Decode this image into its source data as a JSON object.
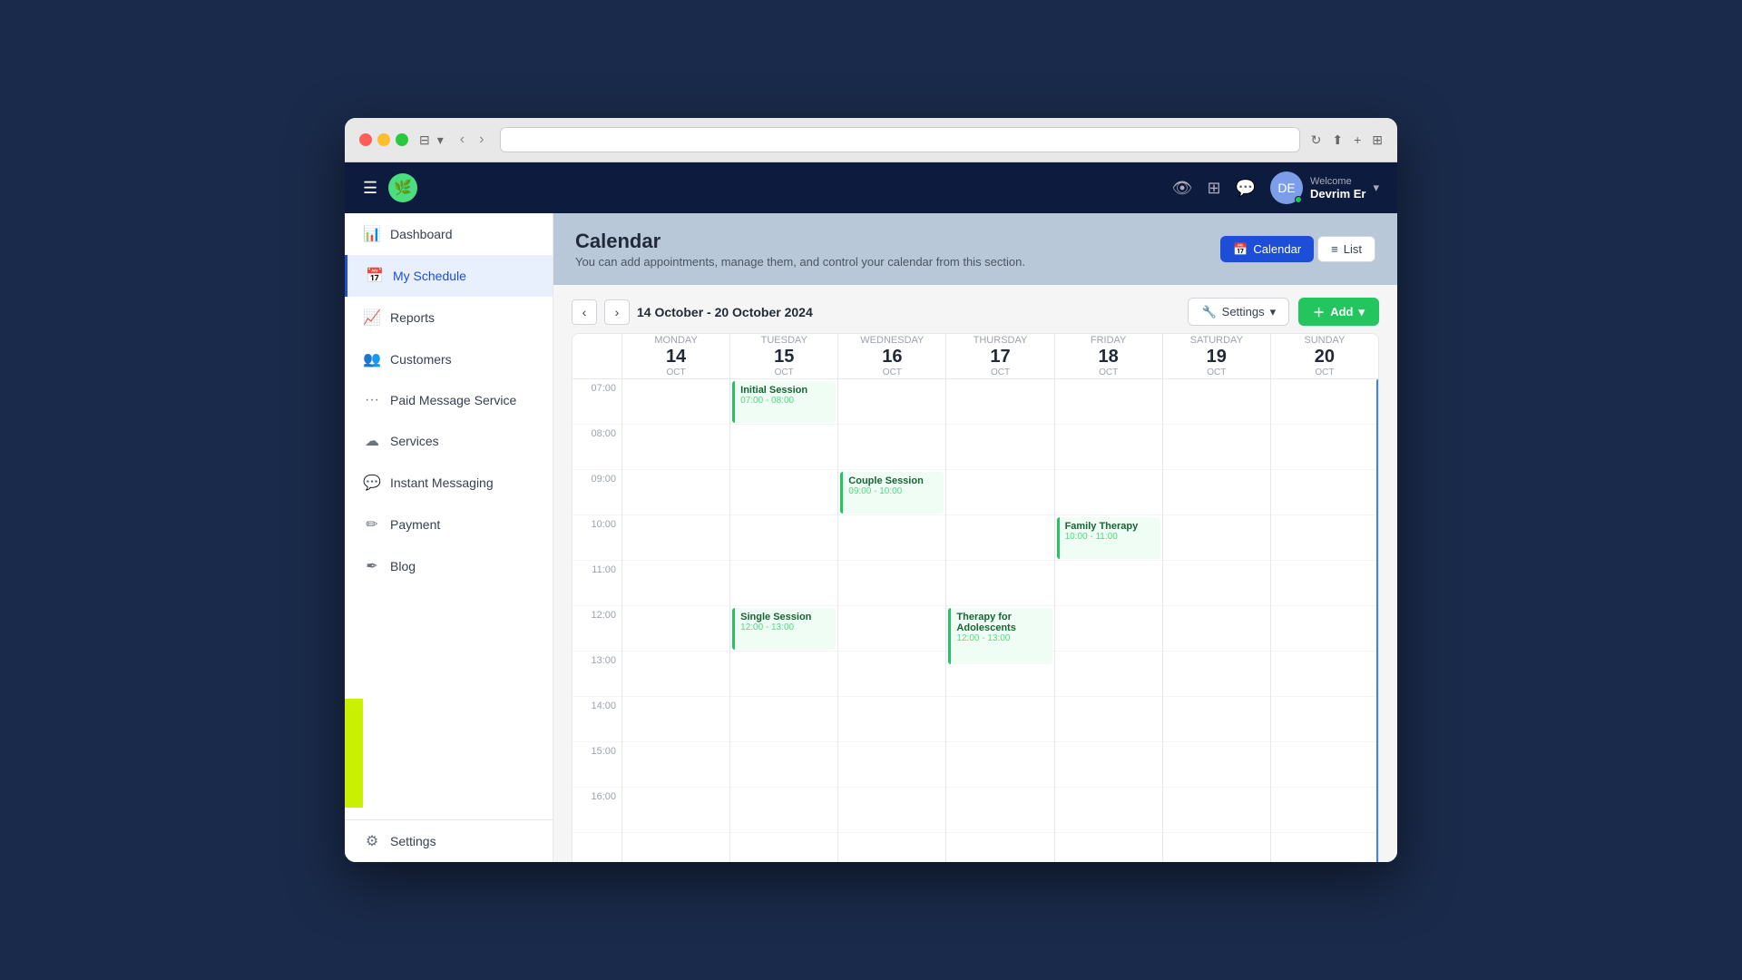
{
  "browser": {
    "back_label": "‹",
    "forward_label": "›",
    "refresh_label": "↻",
    "share_label": "⬆",
    "add_tab_label": "+",
    "grid_label": "⊞"
  },
  "topnav": {
    "hamburger_label": "☰",
    "logo_emoji": "🌿",
    "welcome_text": "Welcome",
    "username": "Devrim Er",
    "chevron": "▾",
    "icon_eye": "👁",
    "icon_grid": "⊞",
    "icon_chat": "💬"
  },
  "sidebar": {
    "items": [
      {
        "id": "dashboard",
        "label": "Dashboard",
        "icon": "📊"
      },
      {
        "id": "my-schedule",
        "label": "My Schedule",
        "icon": "📅",
        "active": true
      },
      {
        "id": "reports",
        "label": "Reports",
        "icon": "📈"
      },
      {
        "id": "customers",
        "label": "Customers",
        "icon": "👥"
      },
      {
        "id": "paid-message",
        "label": "Paid Message Service",
        "icon": "···"
      },
      {
        "id": "services",
        "label": "Services",
        "icon": "☁"
      },
      {
        "id": "instant-messaging",
        "label": "Instant Messaging",
        "icon": "💬"
      },
      {
        "id": "payment",
        "label": "Payment",
        "icon": "✏"
      },
      {
        "id": "blog",
        "label": "Blog",
        "icon": "✒"
      }
    ],
    "bottom_items": [
      {
        "id": "settings",
        "label": "Settings",
        "icon": "⚙"
      }
    ]
  },
  "page_header": {
    "title": "Calendar",
    "subtitle": "You can add appointments, manage them, and control your calendar from this section.",
    "view_calendar_label": "Calendar",
    "view_list_label": "List"
  },
  "calendar": {
    "date_range": "14 October - 20 October 2024",
    "settings_label": "Settings",
    "add_label": "+ Add",
    "days": [
      {
        "name": "Monday",
        "number": "14",
        "month": "OCT"
      },
      {
        "name": "Tuesday",
        "number": "15",
        "month": "OCT"
      },
      {
        "name": "Wednesday",
        "number": "16",
        "month": "OCT"
      },
      {
        "name": "Thursday",
        "number": "17",
        "month": "OCT"
      },
      {
        "name": "Friday",
        "number": "18",
        "month": "OCT"
      },
      {
        "name": "Saturday",
        "number": "19",
        "month": "OCT"
      },
      {
        "name": "Sunday",
        "number": "20",
        "month": "OCT"
      }
    ],
    "time_slots": [
      "07:00",
      "08:00",
      "09:00",
      "10:00",
      "11:00",
      "12:00",
      "13:00",
      "14:00",
      "15:00",
      "16:00"
    ],
    "events": [
      {
        "id": "evt1",
        "title": "Initial Session",
        "time": "07:00 - 08:00",
        "day_index": 1,
        "slot_index": 0,
        "height_slots": 1
      },
      {
        "id": "evt2",
        "title": "Couple Session",
        "time": "09:00 - 10:00",
        "day_index": 2,
        "slot_index": 2,
        "height_slots": 1
      },
      {
        "id": "evt3",
        "title": "Family Therapy",
        "time": "10:00 - 11:00",
        "day_index": 4,
        "slot_index": 3,
        "height_slots": 1
      },
      {
        "id": "evt4",
        "title": "Single Session",
        "time": "12:00 - 13:00",
        "day_index": 1,
        "slot_index": 5,
        "height_slots": 1
      },
      {
        "id": "evt5",
        "title": "Therapy for Adolescents",
        "time": "12:00 - 13:00",
        "day_index": 3,
        "slot_index": 5,
        "height_slots": 1
      }
    ]
  }
}
